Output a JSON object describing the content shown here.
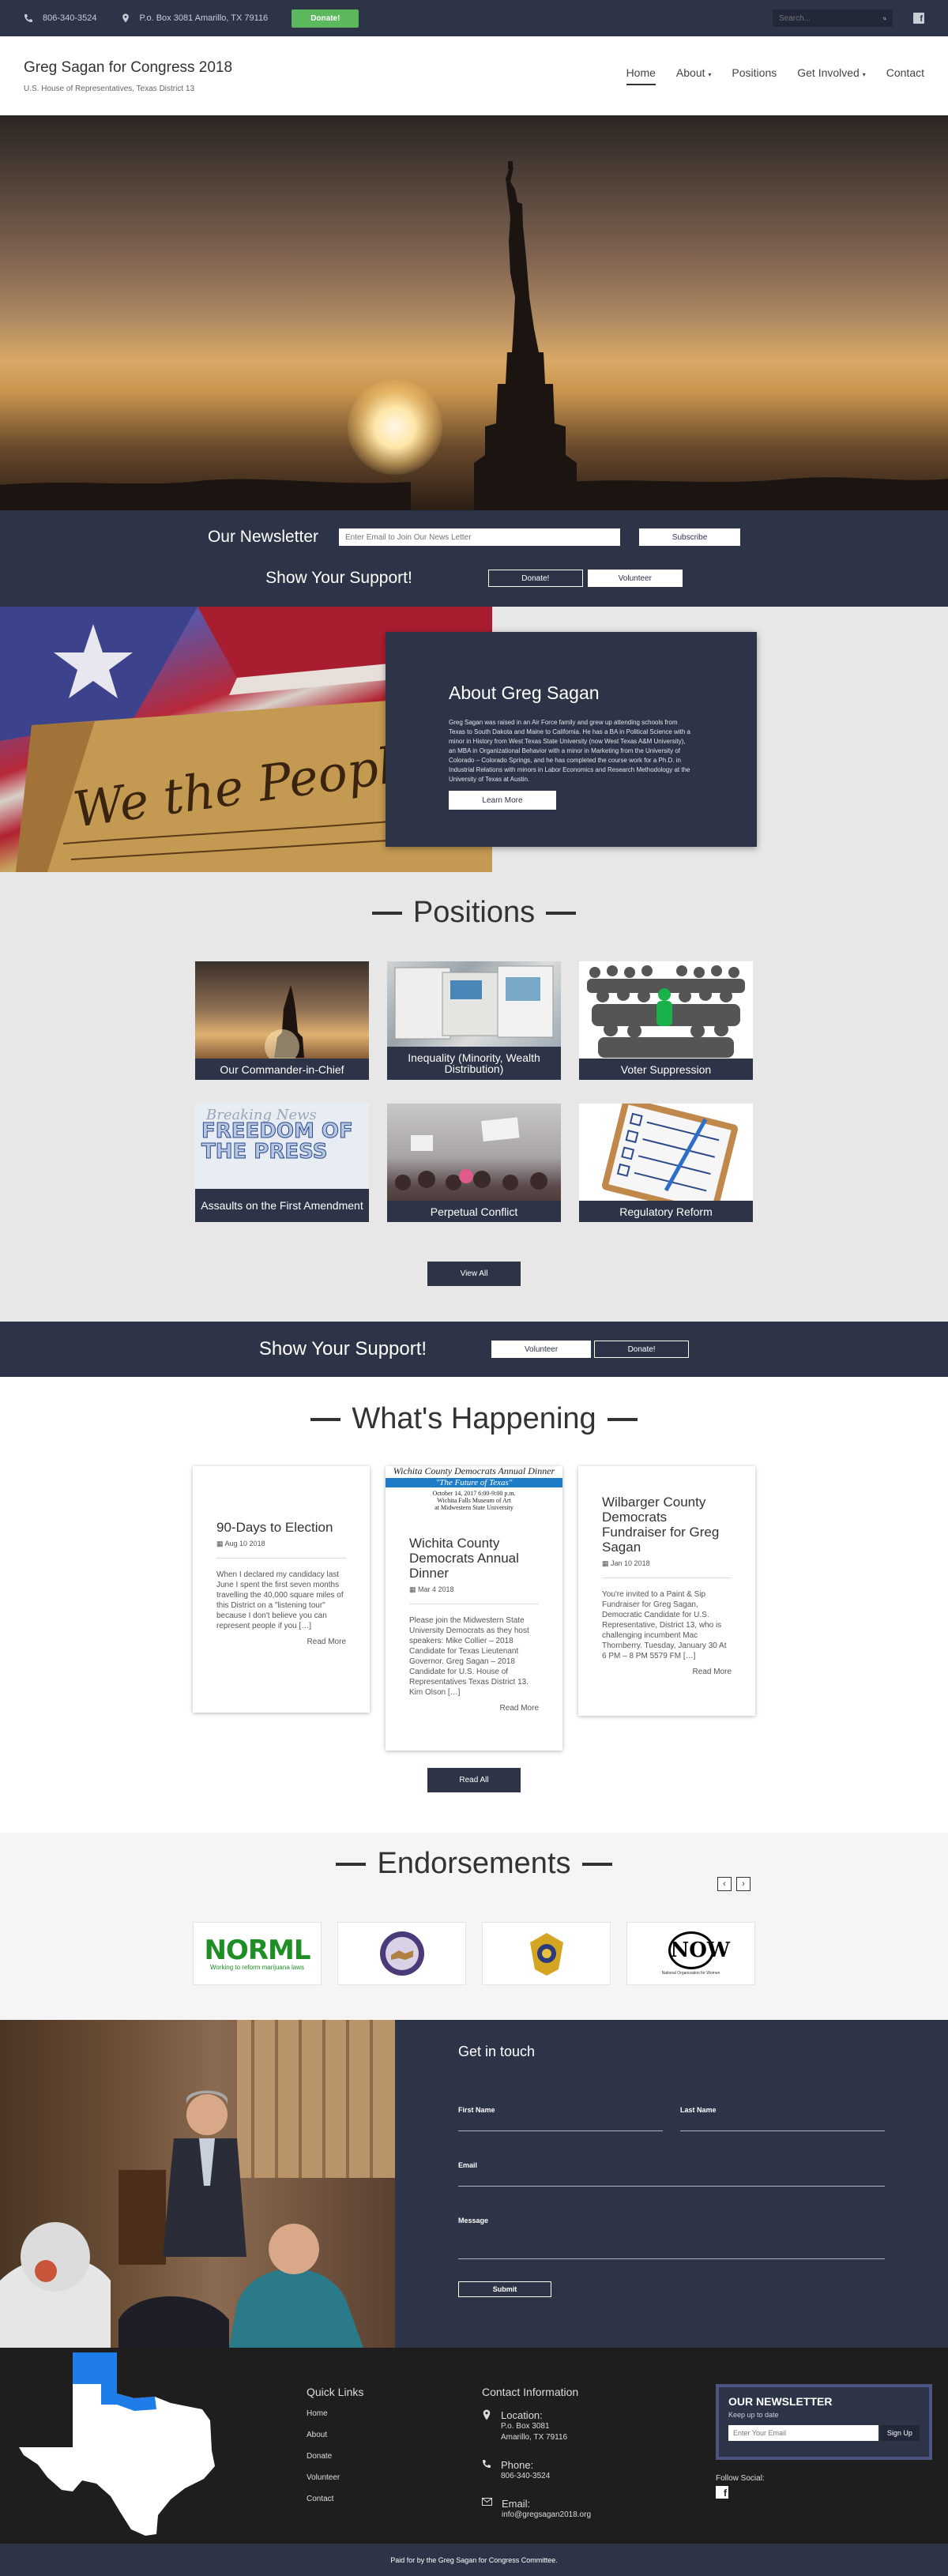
{
  "topbar": {
    "phone": "806-340-3524",
    "address": "P.o. Box 3081 Amarillo, TX 79116",
    "donate_label": "Donate!",
    "search_placeholder": "Search..."
  },
  "header": {
    "title": "Greg Sagan for Congress 2018",
    "subtitle": "U.S. House of Representatives, Texas District 13",
    "nav": [
      {
        "label": "Home"
      },
      {
        "label": "About"
      },
      {
        "label": "Positions"
      },
      {
        "label": "Get Involved"
      },
      {
        "label": "Contact"
      }
    ]
  },
  "newsletter": {
    "title": "Our Newsletter",
    "placeholder": "Enter Email to Join Our News Letter",
    "subscribe_label": "Subscribe",
    "support_title": "Show Your Support!",
    "donate_label": "Donate!",
    "volunteer_label": "Volunteer"
  },
  "about": {
    "title": "About Greg Sagan",
    "body": "Greg Sagan was raised in an Air Force family and grew up attending schools from Texas to South Dakota and Maine to California. He has a BA in Political Science with a minor in History from West Texas State University (now West Texas A&M University), an MBA in Organizational Behavior with a minor in Marketing from the University of Colorado – Colorado Springs, and he has completed the course work for a Ph.D. in Industrial Relations with minors in Labor Economics and Research Methodology at the University of Texas at Austin.",
    "button_label": "Learn More"
  },
  "positions": {
    "title": "Positions",
    "items": [
      {
        "label": "Our Commander-in-Chief"
      },
      {
        "label": "Inequality (Minority, Wealth Distribution)"
      },
      {
        "label": "Voter Suppression"
      },
      {
        "label": "Assaults on the First Amendment"
      },
      {
        "label": "Perpetual Conflict"
      },
      {
        "label": "Regulatory Reform"
      }
    ],
    "press_text": "FREEDOM OF THE PRESS",
    "view_all_label": "View All"
  },
  "support": {
    "title": "Show Your Support!",
    "volunteer_label": "Volunteer",
    "donate_label": "Donate!"
  },
  "happening": {
    "title": "What's Happening",
    "poster": {
      "title": "Wichita County Democrats Annual Dinner",
      "theme": "\"The Future of Texas\"",
      "line1": "October 14, 2017  6:00-9:00 p.m.",
      "line2": "Wichita Falls Museum of Art",
      "line3": "at Midwestern State University"
    },
    "events": [
      {
        "title": "90-Days to Election",
        "date": "Aug 10 2018",
        "excerpt": "When I declared my candidacy last June I spent the first seven months travelling the 40,000 square miles of this District on a \"listening tour\" because I don't believe you can represent people if you […]",
        "more": "Read More"
      },
      {
        "title": "Wichita County Democrats Annual Dinner",
        "date": "Mar 4 2018",
        "excerpt": "Please join the Midwestern State University Democrats as they host speakers: Mike Collier – 2018 Candidate for Texas Lieutenant Governor. Greg Sagan – 2018 Candidate for U.S. House of Representatives Texas District 13. Kim Olson […]",
        "more": "Read More"
      },
      {
        "title": "Wilbarger County Democrats Fundraiser for Greg Sagan",
        "date": "Jan 10 2018",
        "excerpt": "You're invited to a Paint & Sip Fundraiser for Greg Sagan, Democratic Candidate for U.S. Representative, District 13, who is challenging incumbent Mac Thornberry. Tuesday, January 30 At 6 PM – 8 PM 5579 FM […]",
        "more": "Read More"
      }
    ],
    "read_all_label": "Read All"
  },
  "endorsements": {
    "title": "Endorsements",
    "logos": [
      {
        "name": "NORML",
        "tagline": "Working to reform marijuana laws"
      },
      {
        "name": "seal-logo"
      },
      {
        "name": "teamsters-logo"
      },
      {
        "name": "NOW",
        "tagline": "National Organization for Women"
      }
    ]
  },
  "contact": {
    "title": "Get in touch",
    "first_name_label": "First Name",
    "last_name_label": "Last Name",
    "email_label": "Email",
    "message_label": "Message",
    "submit_label": "Submit"
  },
  "footer": {
    "quick_links_title": "Quick Links",
    "quick_links": [
      "Home",
      "About",
      "Donate",
      "Volunteer",
      "Contact"
    ],
    "contact_title": "Contact Information",
    "location_label": "Location:",
    "location_line1": "P.o. Box 3081",
    "location_line2": "Amarillo, TX 79116",
    "phone_label": "Phone:",
    "phone": "806-340-3524",
    "email_label": "Email:",
    "email": "info@gregsagan2018.org",
    "newsletter_title": "OUR NEWSLETTER",
    "newsletter_sub": "Keep up to date",
    "newsletter_placeholder": "Enter Your Email",
    "signup_label": "Sign Up",
    "follow_label": "Follow Social:",
    "paid_for": "Paid for by the Greg Sagan for Congress Committee."
  },
  "colors": {
    "navy": "#2e3447",
    "donate_green": "#5cb85c",
    "footer_dark": "#1e1e1e",
    "texas_highlight": "#1e7de8"
  }
}
